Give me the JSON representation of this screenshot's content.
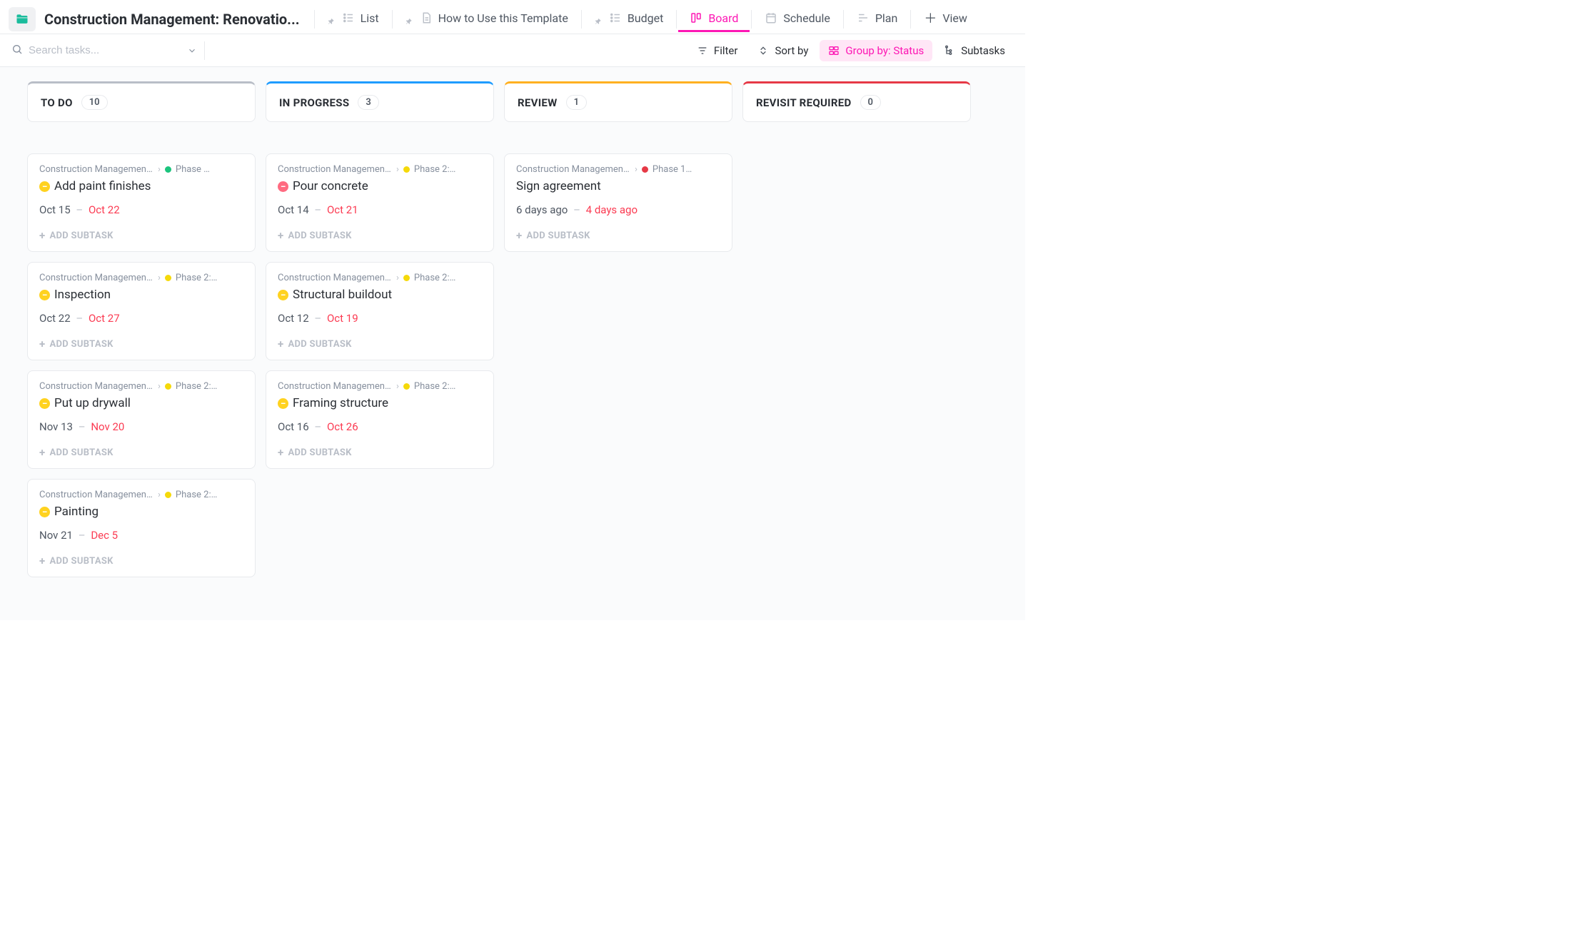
{
  "app_title": "Construction Management: Renovatio...",
  "search_placeholder": "Search tasks...",
  "nav_tabs": [
    {
      "id": "list",
      "label": "List"
    },
    {
      "id": "how-to",
      "label": "How to Use this Template"
    },
    {
      "id": "budget",
      "label": "Budget"
    },
    {
      "id": "board",
      "label": "Board",
      "active": true
    },
    {
      "id": "schedule",
      "label": "Schedule"
    },
    {
      "id": "plan",
      "label": "Plan"
    }
  ],
  "view_add_label": "View",
  "toolbar": {
    "filter_label": "Filter",
    "sort_label": "Sort by",
    "group_label": "Group by: Status",
    "subtasks_label": "Subtasks"
  },
  "add_subtask_label": "ADD SUBTASK",
  "columns": [
    {
      "id": "todo",
      "title": "TO DO",
      "count": 10,
      "color": "#b9bec7"
    },
    {
      "id": "progress",
      "title": "IN PROGRESS",
      "count": 3,
      "color": "#1f9cff"
    },
    {
      "id": "review",
      "title": "REVIEW",
      "count": 1,
      "color": "#ffb020"
    },
    {
      "id": "revisit",
      "title": "REVISIT REQUIRED",
      "count": 0,
      "color": "#e63946"
    }
  ],
  "cards": {
    "todo": [
      {
        "title": "Add paint finishes",
        "bc1": "Construction Management: Ren…",
        "bc2": "Phase …",
        "phase_dot": "#1bc47d",
        "priority": "yellow",
        "start": "Oct 15",
        "due": "Oct 22"
      },
      {
        "title": "Inspection",
        "bc1": "Construction Management: R…",
        "bc2": "Phase 2:…",
        "phase_dot": "#f5d90a",
        "priority": "yellow",
        "start": "Oct 22",
        "due": "Oct 27"
      },
      {
        "title": "Put up drywall",
        "bc1": "Construction Management: R…",
        "bc2": "Phase 2:…",
        "phase_dot": "#f5d90a",
        "priority": "yellow",
        "start": "Nov 13",
        "due": "Nov 20"
      },
      {
        "title": "Painting",
        "bc1": "Construction Management: R…",
        "bc2": "Phase 2:…",
        "phase_dot": "#f5d90a",
        "priority": "yellow",
        "start": "Nov 21",
        "due": "Dec 5"
      }
    ],
    "progress": [
      {
        "title": "Pour concrete",
        "bc1": "Construction Management: R…",
        "bc2": "Phase 2:…",
        "phase_dot": "#f5d90a",
        "priority": "red",
        "start": "Oct 14",
        "due": "Oct 21"
      },
      {
        "title": "Structural buildout",
        "bc1": "Construction Management: R…",
        "bc2": "Phase 2:…",
        "phase_dot": "#f5d90a",
        "priority": "yellow",
        "start": "Oct 12",
        "due": "Oct 19"
      },
      {
        "title": "Framing structure",
        "bc1": "Construction Management: R…",
        "bc2": "Phase 2:…",
        "phase_dot": "#f5d90a",
        "priority": "yellow",
        "start": "Oct 16",
        "due": "Oct 26"
      }
    ],
    "review": [
      {
        "title": "Sign agreement",
        "bc1": "Construction Management: Ren…",
        "bc2": "Phase 1…",
        "phase_dot": "#e63946",
        "priority": "none",
        "start": "6 days ago",
        "due": "4 days ago"
      }
    ],
    "revisit": []
  }
}
